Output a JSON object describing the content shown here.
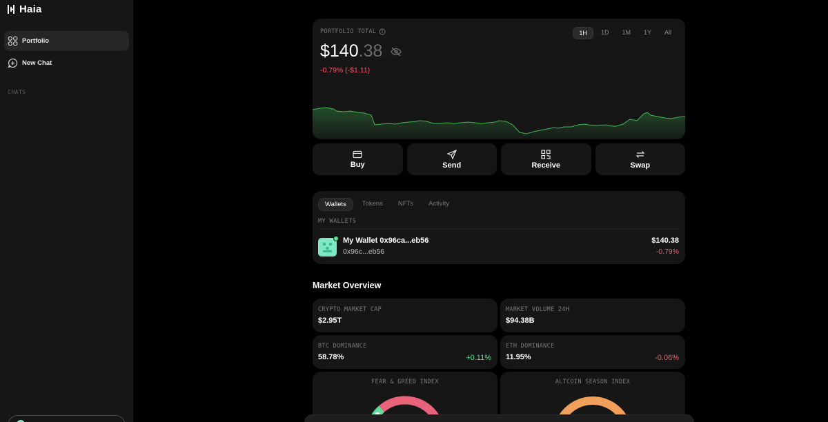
{
  "app": {
    "name": "Haia"
  },
  "sidebar": {
    "items": [
      {
        "label": "Portfolio",
        "icon": "grid-icon",
        "active": true
      },
      {
        "label": "New Chat",
        "icon": "new-chat-icon",
        "active": false
      }
    ],
    "chats_label": "CHATS"
  },
  "portfolio": {
    "label": "PORTFOLIO TOTAL",
    "value_int": "$140",
    "value_dec": ".38",
    "change": "-0.79% (-$1.11)",
    "ranges": [
      "1H",
      "1D",
      "1M",
      "1Y",
      "All"
    ],
    "active_range": "1H"
  },
  "actions": [
    {
      "label": "Buy",
      "icon": "card-icon"
    },
    {
      "label": "Send",
      "icon": "send-icon"
    },
    {
      "label": "Receive",
      "icon": "qr-icon"
    },
    {
      "label": "Swap",
      "icon": "swap-icon"
    }
  ],
  "wallets": {
    "tabs": [
      "Wallets",
      "Tokens",
      "NFTs",
      "Activity"
    ],
    "active_tab": "Wallets",
    "section_label": "MY WALLETS",
    "items": [
      {
        "name": "My Wallet 0x96ca...eb56",
        "address": "0x96c...eb56",
        "value": "$140.38",
        "change": "-0.79%"
      }
    ]
  },
  "market": {
    "title": "Market Overview",
    "stats": [
      {
        "label": "CRYPTO MARKET CAP",
        "value": "$2.95T",
        "change": ""
      },
      {
        "label": "MARKET VOLUME 24H",
        "value": "$94.38B",
        "change": ""
      },
      {
        "label": "BTC DOMINANCE",
        "value": "58.78%",
        "change": "+0.11%"
      },
      {
        "label": "ETH DOMINANCE",
        "value": "11.95%",
        "change": "-0.06%"
      }
    ],
    "gauges": [
      {
        "label": "FEAR & GREED INDEX"
      },
      {
        "label": "ALTCOIN SEASON INDEX"
      }
    ]
  },
  "colors": {
    "accent_green": "#5fe09a",
    "negative_red": "#f05a6b",
    "fear_pink": "#e8627a",
    "altcoin_orange": "#f0a05a"
  }
}
